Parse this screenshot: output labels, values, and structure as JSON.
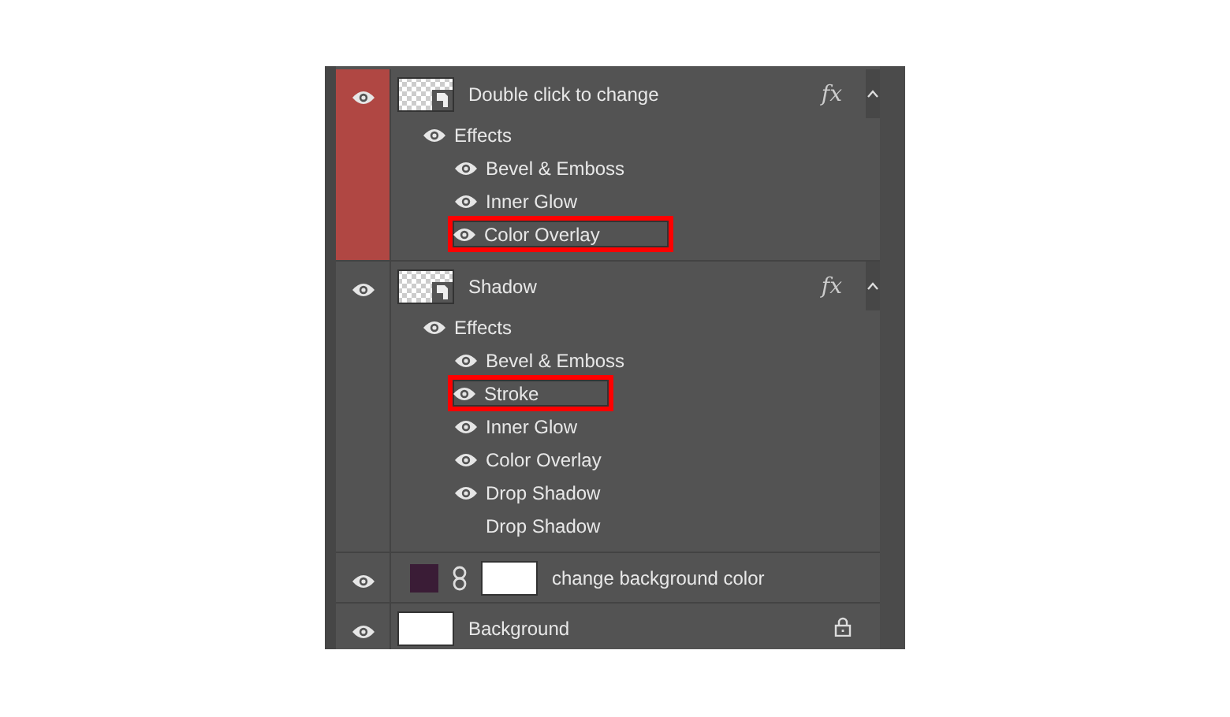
{
  "layers": [
    {
      "kind": "smart",
      "name": "Double click to change",
      "selected": true,
      "visible": true,
      "fx": "fx",
      "expanded": true,
      "effects_header": {
        "label": "Effects",
        "visible": true
      },
      "effects": [
        {
          "label": "Bevel & Emboss",
          "visible": true,
          "highlighted": false
        },
        {
          "label": "Inner Glow",
          "visible": true,
          "highlighted": false
        },
        {
          "label": "Color Overlay",
          "visible": true,
          "highlighted": true
        }
      ]
    },
    {
      "kind": "smart",
      "name": "Shadow",
      "selected": false,
      "visible": true,
      "fx": "fx",
      "expanded": true,
      "effects_header": {
        "label": "Effects",
        "visible": true
      },
      "effects": [
        {
          "label": "Bevel & Emboss",
          "visible": true,
          "highlighted": false
        },
        {
          "label": "Stroke",
          "visible": true,
          "highlighted": true
        },
        {
          "label": "Inner Glow",
          "visible": true,
          "highlighted": false
        },
        {
          "label": "Color Overlay",
          "visible": true,
          "highlighted": false
        },
        {
          "label": "Drop Shadow",
          "visible": true,
          "highlighted": false
        },
        {
          "label": "Drop Shadow",
          "visible": false,
          "highlighted": false
        }
      ]
    },
    {
      "kind": "fill",
      "name": "change background color",
      "selected": false,
      "visible": true,
      "color": "#3a1c36"
    },
    {
      "kind": "background",
      "name": "Background",
      "selected": false,
      "visible": true,
      "locked": true
    }
  ]
}
